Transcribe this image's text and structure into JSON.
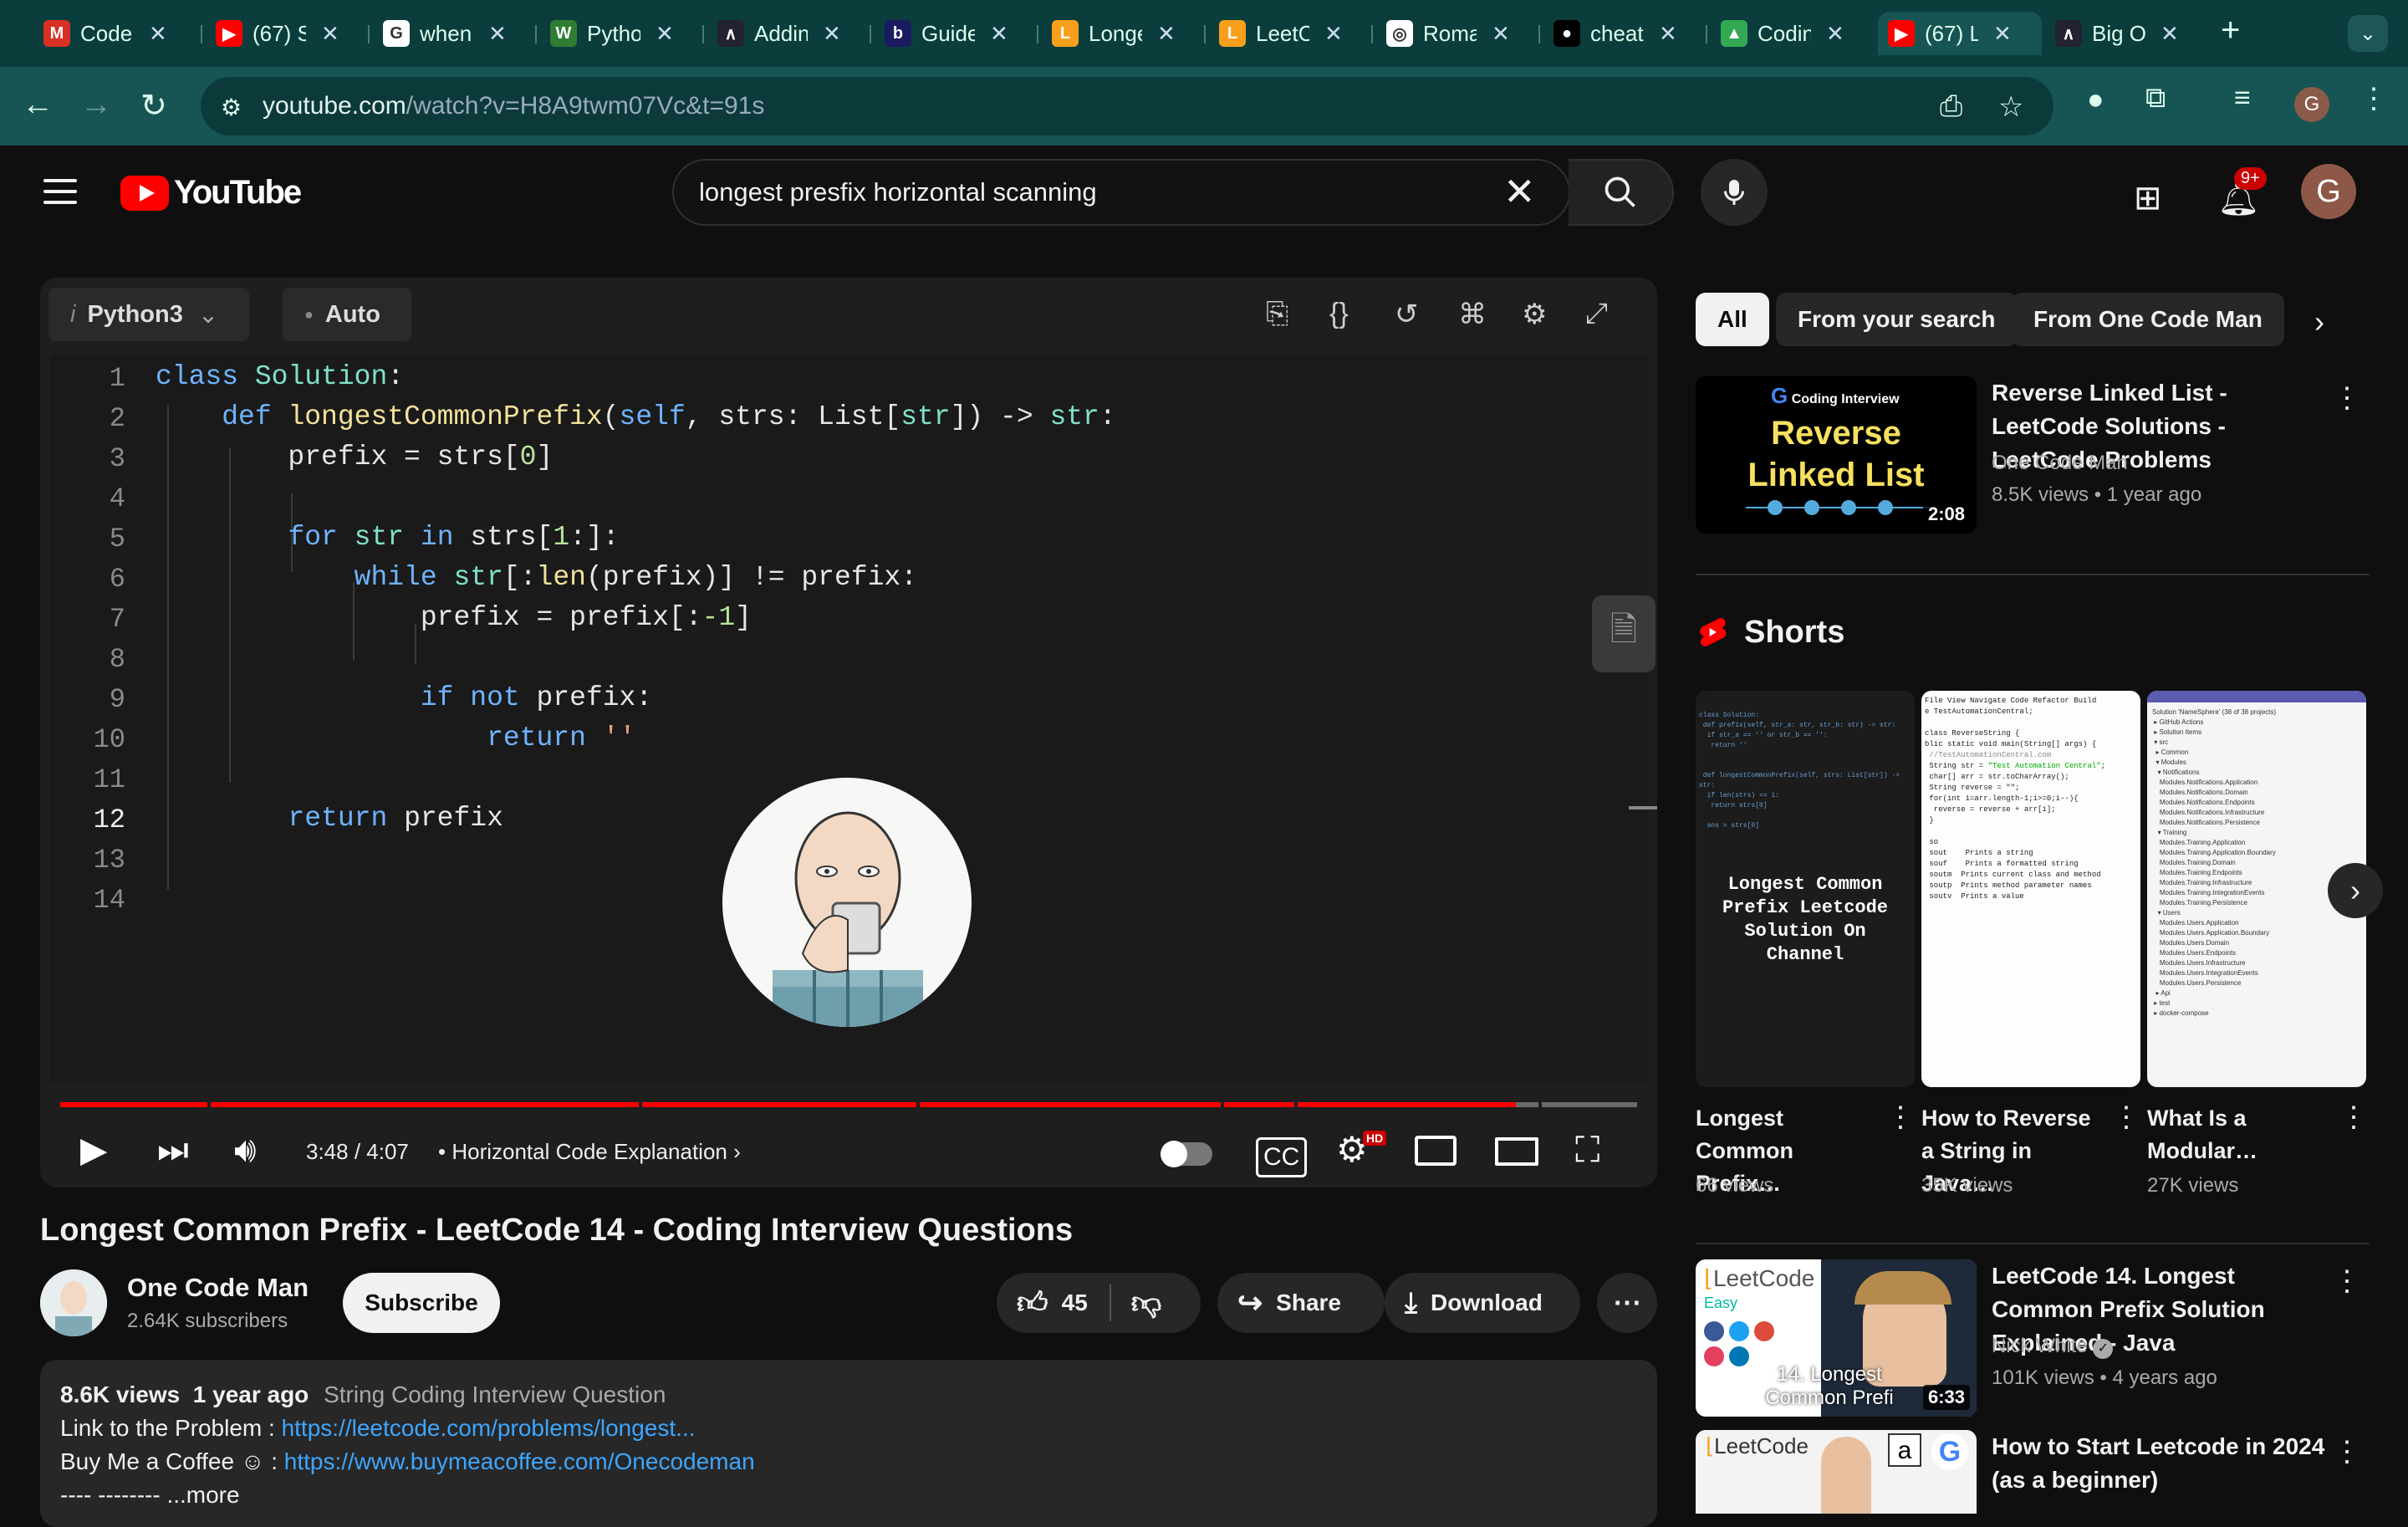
{
  "browser": {
    "tabs": [
      {
        "title": "Code",
        "color": "#d93025",
        "glyph": "M"
      },
      {
        "title": "(67) S",
        "color": "#ff0000",
        "glyph": "▶"
      },
      {
        "title": "when",
        "color": "#ffffff",
        "glyph": "G"
      },
      {
        "title": "Pytho",
        "color": "#2e7d32",
        "glyph": "W"
      },
      {
        "title": "Addin",
        "color": "#222233",
        "glyph": "∧"
      },
      {
        "title": "Guide",
        "color": "#1a1a60",
        "glyph": "b"
      },
      {
        "title": "Longe",
        "color": "#f89f1b",
        "glyph": "L"
      },
      {
        "title": "LeetC",
        "color": "#f89f1b",
        "glyph": "L"
      },
      {
        "title": "Roma",
        "color": "#ffffff",
        "glyph": "◎"
      },
      {
        "title": "cheat",
        "color": "#000000",
        "glyph": "●"
      },
      {
        "title": "Codin",
        "color": "#34a853",
        "glyph": "▲"
      },
      {
        "title": "(67) L",
        "color": "#ff0000",
        "glyph": "▶"
      },
      {
        "title": "Big O",
        "color": "#222233",
        "glyph": "∧"
      }
    ],
    "url_domain": "youtube.com",
    "url_path": "/watch?v=H8A9twm07Vc&t=91s",
    "profile_initial": "G"
  },
  "header": {
    "logo_text": "YouTube",
    "search_value": "longest presfix horizontal scanning",
    "notif_badge": "9+",
    "avatar_initial": "G"
  },
  "editor": {
    "language": "Python3",
    "mode": "Auto",
    "line_numbers": [
      "1",
      "2",
      "3",
      "4",
      "5",
      "6",
      "7",
      "8",
      "9",
      "10",
      "11",
      "12",
      "13",
      "14"
    ],
    "current_line": "12"
  },
  "player": {
    "time": "3:48 / 4:07",
    "chapter": "Horizontal Code Explanation",
    "progress_fraction": 0.923
  },
  "video": {
    "title": "Longest Common Prefix - LeetCode 14 - Coding Interview Questions",
    "channel": "One Code Man",
    "subscribers": "2.64K subscribers",
    "subscribe_label": "Subscribe",
    "likes": "45",
    "share_label": "Share",
    "download_label": "Download",
    "views": "8.6K views",
    "age": "1 year ago",
    "tag": "String Coding Interview Question",
    "desc_line1_prefix": "Link to the Problem : ",
    "desc_line1_link": "https://leetcode.com/problems/longest...",
    "desc_line2_prefix": "Buy Me a Coffee ☺ : ",
    "desc_line2_link": "https://www.buymeacoffee.com/Onecodeman",
    "desc_line3": "----         -------- ...more"
  },
  "sidebar": {
    "chips": [
      "All",
      "From your search",
      "From One Code Man"
    ],
    "rec1": {
      "title": "Reverse Linked List - LeetCode Solutions - LeetCode Problems",
      "channel": "One Code Man",
      "meta": "8.5K views  •  1 year ago",
      "duration": "2:08",
      "thumb_tag": "Coding Interview",
      "thumb_line1": "Reverse",
      "thumb_line2": "Linked List"
    },
    "shorts_heading": "Shorts",
    "shorts": [
      {
        "title": "Longest Common Prefix…",
        "views": "66 views",
        "overlay": "Longest Common Prefix Leetcode Solution On Channel"
      },
      {
        "title": "How to Reverse a String in Java…",
        "views": "35K views"
      },
      {
        "title": "What Is a Modular…",
        "views": "27K views"
      }
    ],
    "rec2": {
      "title": "LeetCode 14. Longest Common Prefix Solution Explained - Java",
      "channel": "Nick White",
      "meta": "101K views  •  4 years ago",
      "duration": "6:33",
      "thumb_brand": "LeetCode",
      "thumb_level": "Easy",
      "thumb_caption": "14. Longest Common Prefi"
    },
    "rec3": {
      "title": "How to Start Leetcode in 2024 (as a beginner)",
      "thumb_brand": "LeetCode"
    }
  }
}
